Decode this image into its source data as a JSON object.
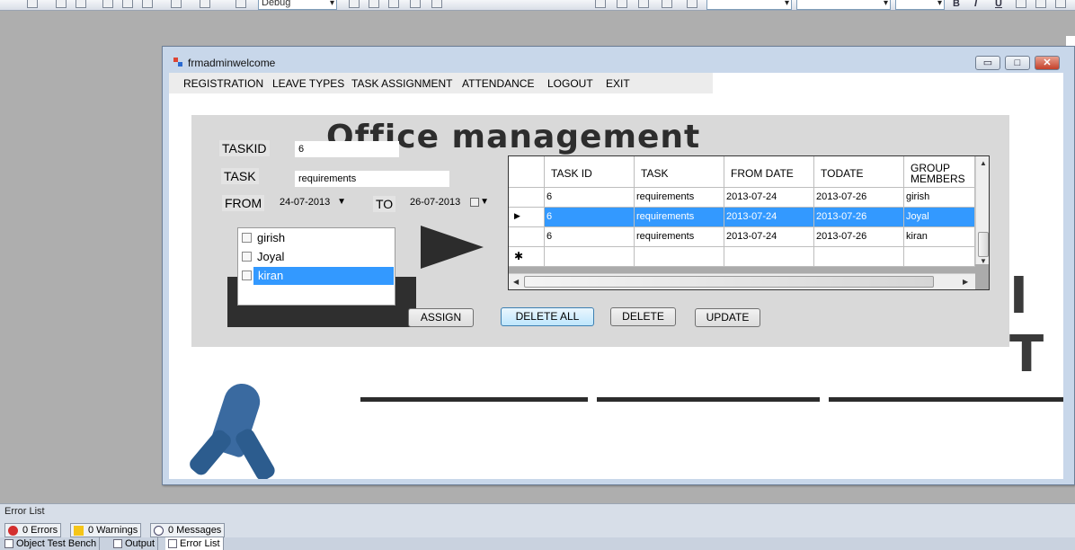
{
  "toolbar": {
    "config_combo": "Debug",
    "format_bold": "B",
    "format_italic": "I",
    "format_underline": "U"
  },
  "window": {
    "title": "frmadminwelcome",
    "min_glyph": "▭",
    "max_glyph": "□",
    "close_glyph": "✕"
  },
  "menu": {
    "items": [
      "REGISTRATION",
      "LEAVE TYPES",
      "TASK ASSIGNMENT",
      "ATTENDANCE",
      "LOGOUT",
      "EXIT"
    ]
  },
  "background": {
    "banner": "Office management",
    "letters": "I T"
  },
  "form": {
    "taskid_label": "TASKID",
    "taskid_value": "6",
    "task_label": "TASK",
    "task_value": "requirements",
    "from_label": "FROM",
    "from_value": "24-07-2013",
    "to_label": "TO",
    "to_value": "26-07-2013"
  },
  "members": [
    {
      "name": "girish",
      "checked": false,
      "selected": false
    },
    {
      "name": "Joyal",
      "checked": false,
      "selected": false
    },
    {
      "name": "kiran",
      "checked": false,
      "selected": true
    }
  ],
  "buttons": {
    "assign": "ASSIGN",
    "delete_all": "DELETE ALL",
    "delete": "DELETE",
    "update": "UPDATE"
  },
  "grid": {
    "columns": [
      "TASK ID",
      "TASK",
      "FROM DATE",
      "TODATE",
      "GROUP MEMBERS"
    ],
    "rows": [
      [
        "6",
        "requirements",
        "2013-07-24",
        "2013-07-26",
        "girish"
      ],
      [
        "6",
        "requirements",
        "2013-07-24",
        "2013-07-26",
        "Joyal"
      ],
      [
        "6",
        "requirements",
        "2013-07-24",
        "2013-07-26",
        "kiran"
      ]
    ],
    "selected_row": 1,
    "new_row_marker": "✱",
    "current_row_marker": "▶"
  },
  "error_list": {
    "title": "Error List",
    "errors": "0 Errors",
    "warnings": "0 Warnings",
    "messages": "0 Messages"
  },
  "bottom_tabs": [
    "Object Test Bench",
    "Output",
    "Error List"
  ]
}
